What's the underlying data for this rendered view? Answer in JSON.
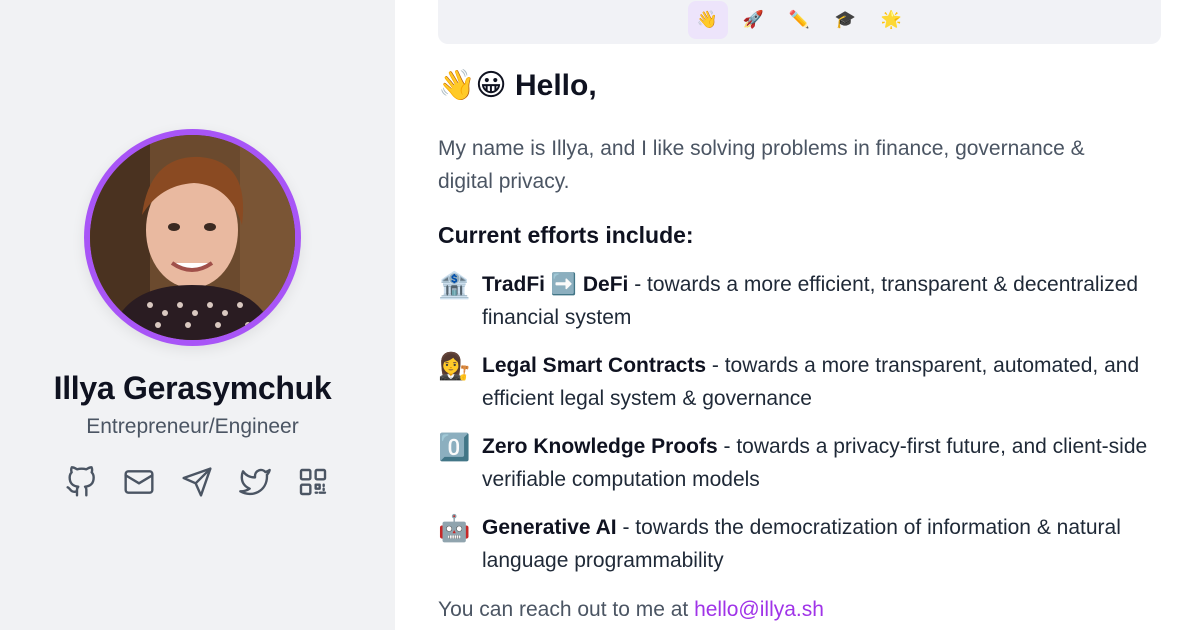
{
  "profile": {
    "name": "Illya Gerasymchuk",
    "role": "Entrepreneur/Engineer"
  },
  "socials": [
    {
      "icon": "github-icon"
    },
    {
      "icon": "mail-icon"
    },
    {
      "icon": "telegram-icon"
    },
    {
      "icon": "twitter-icon"
    },
    {
      "icon": "qr-code-icon"
    }
  ],
  "tabs": [
    {
      "emoji": "👋",
      "active": true
    },
    {
      "emoji": "🚀",
      "active": false
    },
    {
      "emoji": "✏️",
      "active": false
    },
    {
      "emoji": "🎓",
      "active": false
    },
    {
      "emoji": "🌟",
      "active": false
    }
  ],
  "main": {
    "hello_emoji": "👋😀",
    "hello_text": "Hello,",
    "intro": "My name is Illya, and I like solving problems in finance, governance & digital privacy.",
    "efforts_title": "Current efforts include:",
    "efforts": [
      {
        "icon": "🏦",
        "title_a": "TradFi",
        "arrow": "➡️",
        "title_b": "DeFi",
        "desc": " - towards a more efficient, transparent & decentralized financial system"
      },
      {
        "icon": "👩‍⚖️",
        "title_a": "Legal Smart Contracts",
        "arrow": "",
        "title_b": "",
        "desc": " - towards a more transparent, automated, and efficient legal system & governance"
      },
      {
        "icon": "0️⃣",
        "title_a": "Zero Knowledge Proofs",
        "arrow": "",
        "title_b": "",
        "desc": " - towards a privacy-first future, and client-side verifiable computation models"
      },
      {
        "icon": "🤖",
        "title_a": "Generative AI",
        "arrow": "",
        "title_b": "",
        "desc": " - towards the democratization of information & natural language programmability"
      }
    ],
    "reach_text": "You can reach out to me at ",
    "email": "hello@illya.sh"
  },
  "colors": {
    "accent": "#a855f7",
    "link": "#a034e8",
    "sidebar_bg": "#f1f2f4"
  }
}
